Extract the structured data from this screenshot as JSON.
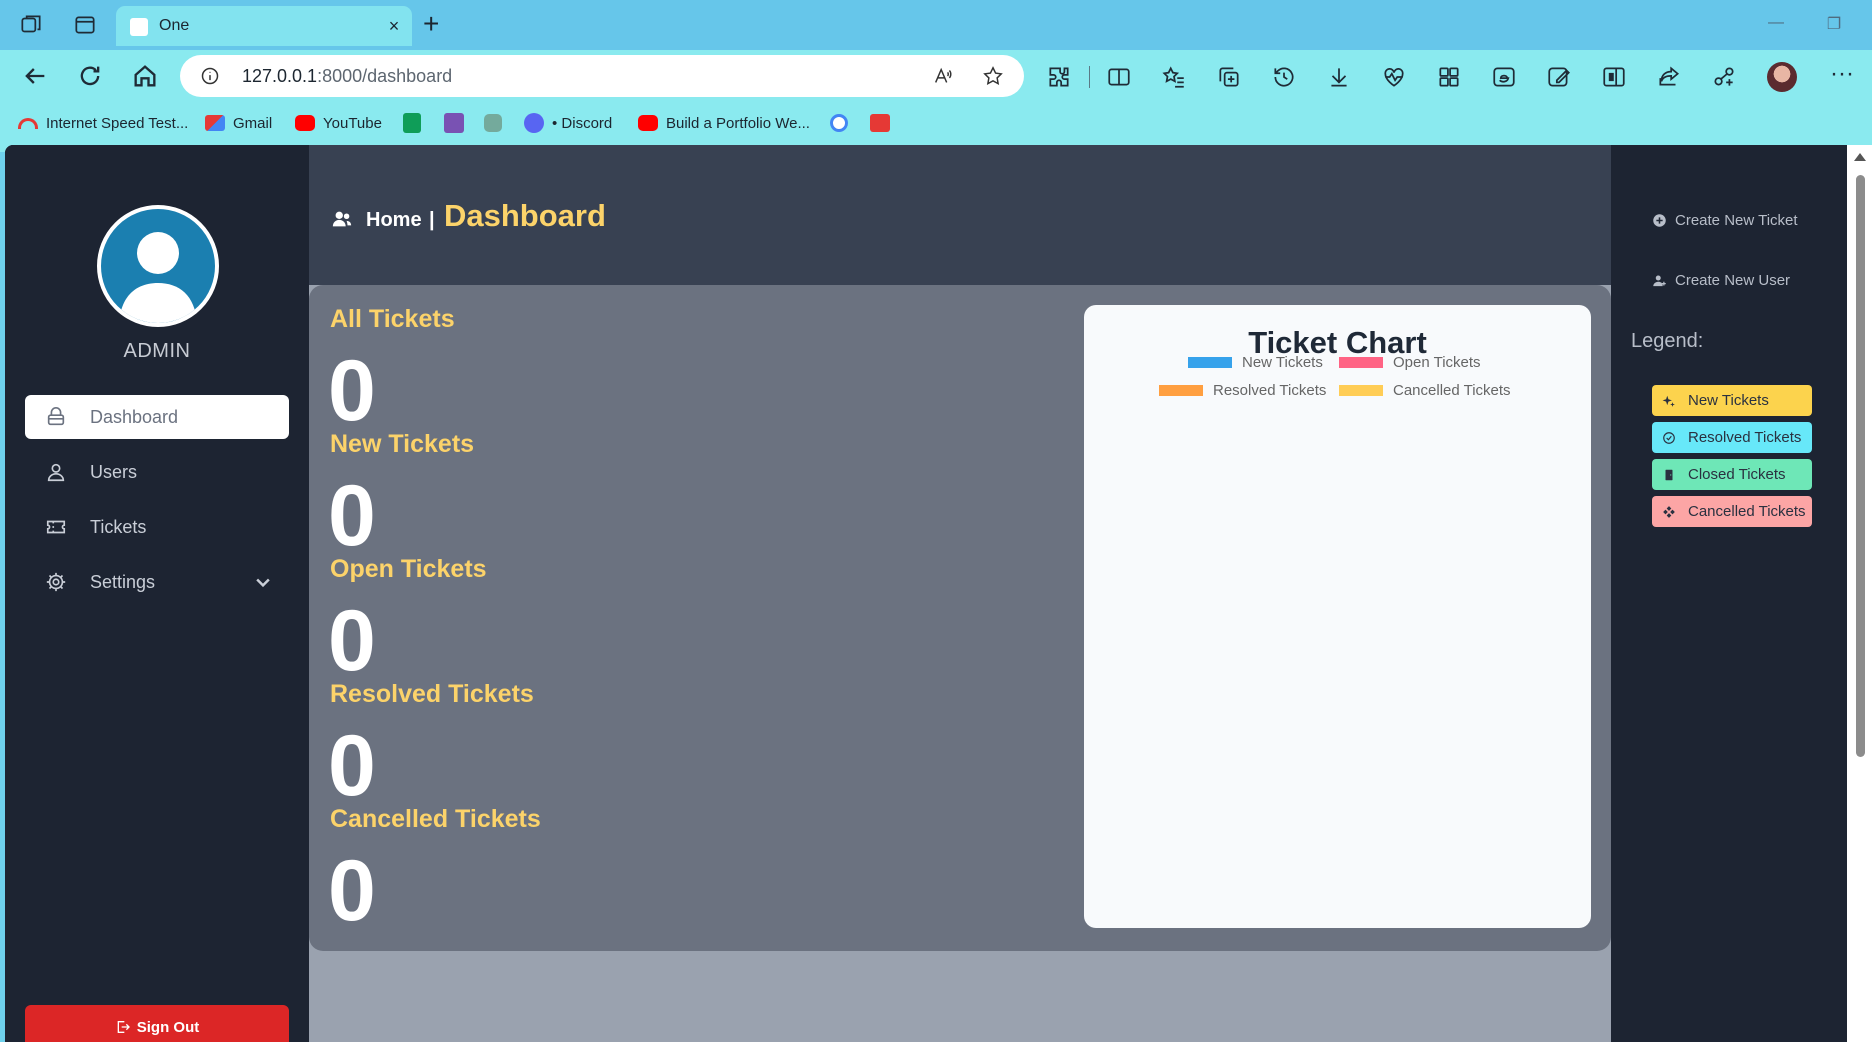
{
  "browser": {
    "tab_title": "One",
    "new_tab": "+",
    "close_tab": "×",
    "url_host": "127.0.0.1",
    "url_path": ":8000/dashboard",
    "bookmarks": [
      {
        "label": "Internet Speed Test...",
        "icon": "speed-icon",
        "color": "#e53935"
      },
      {
        "label": "Gmail",
        "icon": "gmail-icon",
        "color": "#e53935"
      },
      {
        "label": "YouTube",
        "icon": "youtube-icon",
        "color": "#ff0000"
      },
      {
        "label": "",
        "icon": "sheets-icon",
        "color": "#0f9d58"
      },
      {
        "label": "",
        "icon": "bootstrap-icon",
        "color": "#7952b3"
      },
      {
        "label": "",
        "icon": "chatgpt-icon",
        "color": "#74aa9c"
      },
      {
        "label": "• Discord",
        "icon": "discord-icon",
        "color": "#5865f2"
      },
      {
        "label": "Build a Portfolio We...",
        "icon": "youtube-icon",
        "color": "#ff0000"
      },
      {
        "label": "",
        "icon": "google-icon",
        "color": "#4285f4"
      },
      {
        "label": "",
        "icon": "download-red-icon",
        "color": "#e53935"
      }
    ]
  },
  "sidebar": {
    "role": "ADMIN",
    "items": [
      {
        "label": "Dashboard",
        "icon": "lock-icon",
        "active": true
      },
      {
        "label": "Users",
        "icon": "user-icon",
        "active": false
      },
      {
        "label": "Tickets",
        "icon": "ticket-icon",
        "active": false
      },
      {
        "label": "Settings",
        "icon": "gear-icon",
        "active": false
      }
    ],
    "sign_out": "Sign Out"
  },
  "header": {
    "home": "Home",
    "separator": "|",
    "page": "Dashboard"
  },
  "stats": [
    {
      "label": "All Tickets",
      "value": "0"
    },
    {
      "label": "New Tickets",
      "value": "0"
    },
    {
      "label": "Open Tickets",
      "value": "0"
    },
    {
      "label": "Resolved Tickets",
      "value": "0"
    },
    {
      "label": "Cancelled Tickets",
      "value": "0"
    }
  ],
  "chart_data": {
    "type": "bar",
    "title": "Ticket Chart",
    "series": [
      {
        "name": "New Tickets",
        "color": "#36a2eb",
        "values": []
      },
      {
        "name": "Open Tickets",
        "color": "#ff6384",
        "values": []
      },
      {
        "name": "Resolved Tickets",
        "color": "#ff9f40",
        "values": []
      },
      {
        "name": "Cancelled Tickets",
        "color": "#ffcd56",
        "values": []
      }
    ],
    "legend_position": "top"
  },
  "rightbar": {
    "create_ticket": "Create New Ticket",
    "create_user": "Create New User",
    "legend_title": "Legend:",
    "legend": [
      {
        "label": "New Tickets",
        "color": "#fcd34d",
        "icon": "sparkle-icon"
      },
      {
        "label": "Resolved Tickets",
        "color": "#67e8f9",
        "icon": "check-circle-icon"
      },
      {
        "label": "Closed Tickets",
        "color": "#6ee7b7",
        "icon": "door-icon"
      },
      {
        "label": "Cancelled Tickets",
        "color": "#fca5a5",
        "icon": "diamond-icon"
      }
    ]
  }
}
